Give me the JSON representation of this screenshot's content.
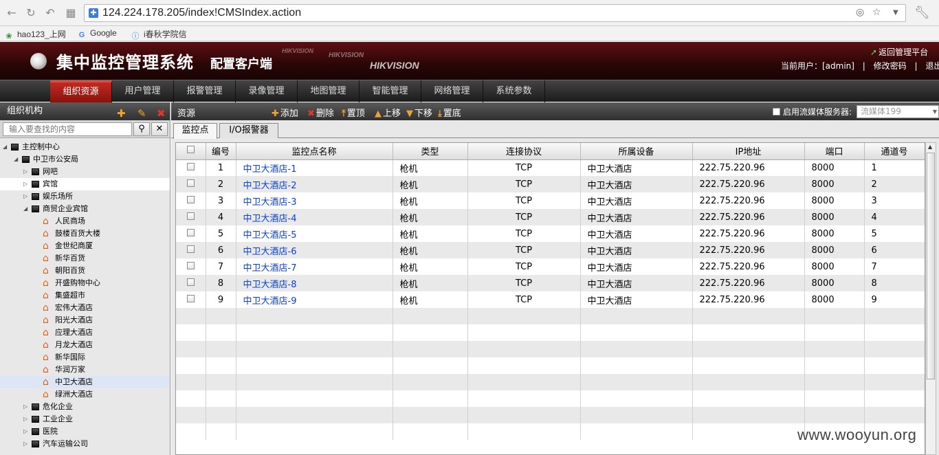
{
  "browser": {
    "url": "124.224.178.205/index!CMSIndex.action",
    "bookmarks": [
      "hao123_上网",
      "Google",
      "i春秋学院信"
    ]
  },
  "header": {
    "title": "集中监控管理系统",
    "subtitle": "配置客户端",
    "brand": "HIKVISION",
    "return_label": "返回管理平台",
    "current_user_label": "当前用户：[admin]",
    "separator": "|",
    "change_password": "修改密码",
    "logout": "退出"
  },
  "menu": [
    "组织资源",
    "用户管理",
    "报警管理",
    "录像管理",
    "地图管理",
    "智能管理",
    "网络管理",
    "系统参数"
  ],
  "left_panel": {
    "title": "组织机构",
    "search_placeholder": "输入要查找的内容"
  },
  "tree": [
    {
      "label": "主控制中心",
      "level": 0,
      "type": "folder",
      "state": "open"
    },
    {
      "label": "中卫市公安局",
      "level": 1,
      "type": "folder",
      "state": "open"
    },
    {
      "label": "网吧",
      "level": 2,
      "type": "folder",
      "state": "closed"
    },
    {
      "label": "宾馆",
      "level": 2,
      "type": "folder",
      "state": "closed",
      "selected": true
    },
    {
      "label": "娱乐场所",
      "level": 2,
      "type": "folder",
      "state": "closed"
    },
    {
      "label": "商贸企业宾馆",
      "level": 2,
      "type": "folder",
      "state": "open"
    },
    {
      "label": "人民商场",
      "level": 3,
      "type": "camera"
    },
    {
      "label": "鼓楼百货大楼",
      "level": 3,
      "type": "camera"
    },
    {
      "label": "金世纪商厦",
      "level": 3,
      "type": "camera"
    },
    {
      "label": "新华百货",
      "level": 3,
      "type": "camera"
    },
    {
      "label": "朝阳百货",
      "level": 3,
      "type": "camera"
    },
    {
      "label": "开盛购物中心",
      "level": 3,
      "type": "camera"
    },
    {
      "label": "集盛超市",
      "level": 3,
      "type": "camera"
    },
    {
      "label": "宏伟大酒店",
      "level": 3,
      "type": "camera"
    },
    {
      "label": "阳光大酒店",
      "level": 3,
      "type": "camera"
    },
    {
      "label": "应理大酒店",
      "level": 3,
      "type": "camera"
    },
    {
      "label": "月龙大酒店",
      "level": 3,
      "type": "camera"
    },
    {
      "label": "新华国际",
      "level": 3,
      "type": "camera"
    },
    {
      "label": "华润万家",
      "level": 3,
      "type": "camera"
    },
    {
      "label": "中卫大酒店",
      "level": 3,
      "type": "camera",
      "highlighted": true
    },
    {
      "label": "绿洲大酒店",
      "level": 3,
      "type": "camera"
    },
    {
      "label": "危化企业",
      "level": 2,
      "type": "folder",
      "state": "closed"
    },
    {
      "label": "工业企业",
      "level": 2,
      "type": "folder",
      "state": "closed"
    },
    {
      "label": "医院",
      "level": 2,
      "type": "folder",
      "state": "closed"
    },
    {
      "label": "汽车运输公司",
      "level": 2,
      "type": "folder",
      "state": "closed"
    }
  ],
  "resource_toolbar": {
    "title": "资源",
    "add": "添加",
    "delete": "删除",
    "top": "置顶",
    "up": "上移",
    "down": "下移",
    "bottom": "置底",
    "stream_label": "启用流媒体服务器:",
    "stream_value": "流媒体199"
  },
  "tabs": [
    "监控点",
    "I/O报警器"
  ],
  "table": {
    "headers": [
      "编号",
      "监控点名称",
      "类型",
      "连接协议",
      "所属设备",
      "IP地址",
      "端口",
      "通道号"
    ],
    "rows": [
      [
        "1",
        "中卫大酒店-1",
        "枪机",
        "TCP",
        "中卫大酒店",
        "222.75.220.96",
        "8000",
        "1"
      ],
      [
        "2",
        "中卫大酒店-2",
        "枪机",
        "TCP",
        "中卫大酒店",
        "222.75.220.96",
        "8000",
        "2"
      ],
      [
        "3",
        "中卫大酒店-3",
        "枪机",
        "TCP",
        "中卫大酒店",
        "222.75.220.96",
        "8000",
        "3"
      ],
      [
        "4",
        "中卫大酒店-4",
        "枪机",
        "TCP",
        "中卫大酒店",
        "222.75.220.96",
        "8000",
        "4"
      ],
      [
        "5",
        "中卫大酒店-5",
        "枪机",
        "TCP",
        "中卫大酒店",
        "222.75.220.96",
        "8000",
        "5"
      ],
      [
        "6",
        "中卫大酒店-6",
        "枪机",
        "TCP",
        "中卫大酒店",
        "222.75.220.96",
        "8000",
        "6"
      ],
      [
        "7",
        "中卫大酒店-7",
        "枪机",
        "TCP",
        "中卫大酒店",
        "222.75.220.96",
        "8000",
        "7"
      ],
      [
        "8",
        "中卫大酒店-8",
        "枪机",
        "TCP",
        "中卫大酒店",
        "222.75.220.96",
        "8000",
        "8"
      ],
      [
        "9",
        "中卫大酒店-9",
        "枪机",
        "TCP",
        "中卫大酒店",
        "222.75.220.96",
        "8000",
        "9"
      ]
    ]
  },
  "watermark": "www.wooyun.org",
  "colors": {
    "menu_active": "#c12a22",
    "link": "#0a3fd8",
    "banner": "#3a0808"
  }
}
